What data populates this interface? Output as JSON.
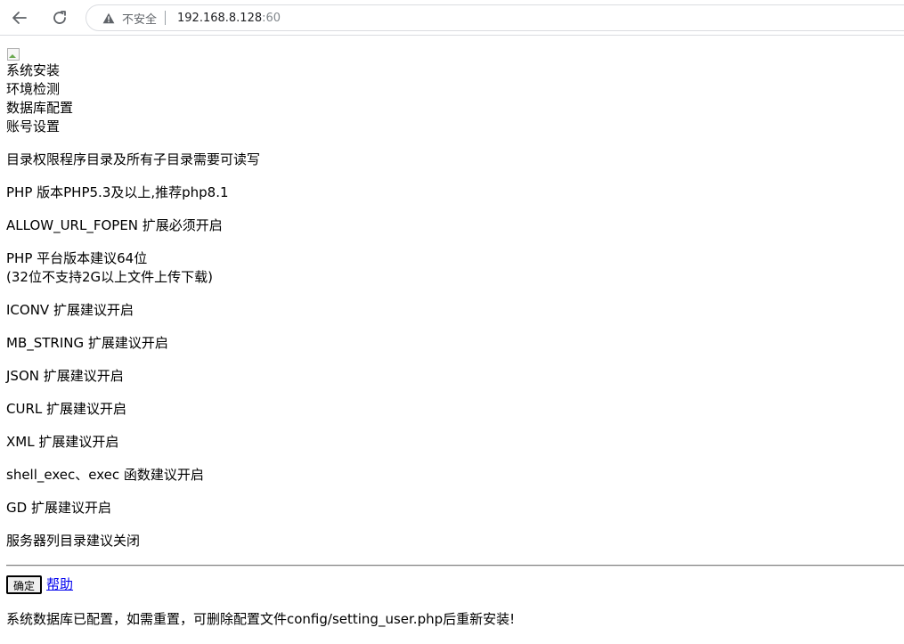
{
  "browser": {
    "security_label": "不安全",
    "url_host": "192.168.8.128",
    "url_port": ":60"
  },
  "steps": [
    "系统安装",
    "环境检测",
    "数据库配置",
    "账号设置"
  ],
  "checks": {
    "dir_permission": "目录权限程序目录及所有子目录需要可读写",
    "php_version": "PHP 版本PHP5.3及以上,推荐php8.1",
    "allow_url_fopen": "ALLOW_URL_FOPEN 扩展必须开启",
    "php_platform_line1": "PHP 平台版本建议64位",
    "php_platform_line2": "(32位不支持2G以上文件上传下载)",
    "iconv": "ICONV 扩展建议开启",
    "mb_string": "MB_STRING 扩展建议开启",
    "json": "JSON 扩展建议开启",
    "curl": "CURL 扩展建议开启",
    "xml": "XML 扩展建议开启",
    "shell_exec": "shell_exec、exec 函数建议开启",
    "gd": "GD 扩展建议开启",
    "dir_listing": "服务器列目录建议关闭"
  },
  "actions": {
    "confirm_label": "确定",
    "help_label": "帮助"
  },
  "footer_note": "系统数据库已配置，如需重置，可删除配置文件config/setting_user.php后重新安装!"
}
